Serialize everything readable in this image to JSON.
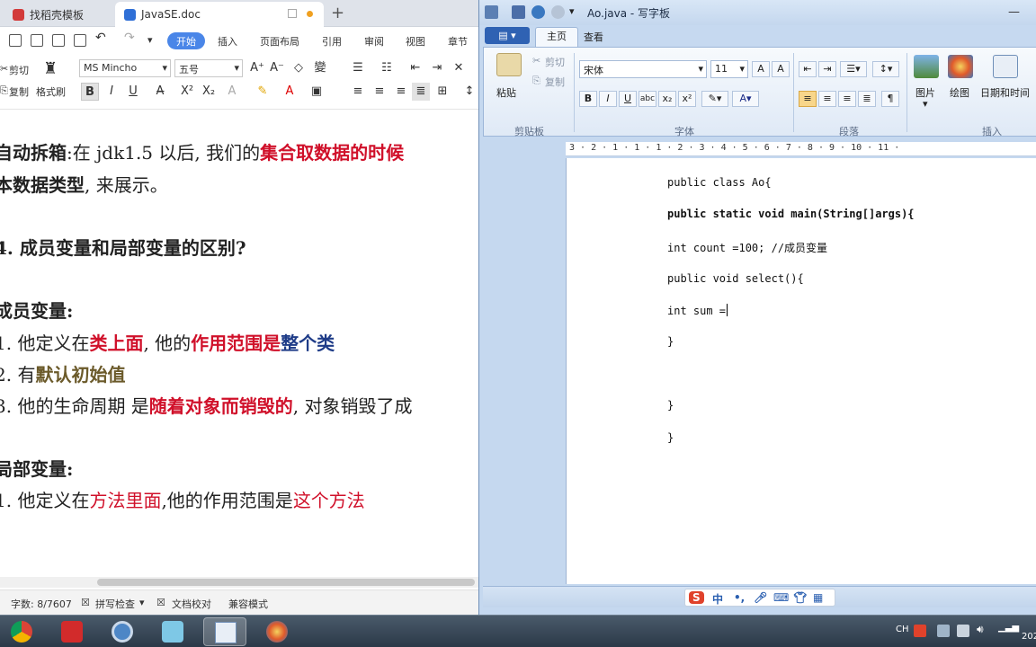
{
  "wps": {
    "tabs": [
      {
        "label": "找稻壳模板",
        "color": "#d23a3a"
      },
      {
        "label": "JavaSE.doc",
        "color": "#2f6fd6"
      }
    ],
    "new_tab": "+",
    "menu": [
      "开始",
      "插入",
      "页面布局",
      "引用",
      "审阅",
      "视图",
      "章节"
    ],
    "clipboard": {
      "cut": "剪切",
      "copy": "复制",
      "format_painter": "格式刷"
    },
    "font_name": "MS Mincho",
    "font_size": "五号",
    "doc_lines": [
      [
        {
          "t": "自动拆箱",
          "c": ""
        },
        {
          "t": ":在 jdk1.5 以后, 我们的",
          "c": ""
        },
        {
          "t": "集合取数据的时候",
          "c": "red b"
        }
      ],
      [
        {
          "t": "本数据类型",
          "c": "b"
        },
        {
          "t": ", 来展示。",
          "c": ""
        }
      ],
      [
        {
          "t": "4.  成员变量和局部变量的区别?",
          "c": "b"
        }
      ],
      [
        {
          "t": "成员变量:",
          "c": "b"
        }
      ],
      [
        {
          "t": "1. 他定义在",
          "c": ""
        },
        {
          "t": "类上面",
          "c": "red b"
        },
        {
          "t": ", 他的",
          "c": ""
        },
        {
          "t": "作用范围是",
          "c": "red b"
        },
        {
          "t": "整个类",
          "c": "blue b"
        }
      ],
      [
        {
          "t": "2. 有",
          "c": ""
        },
        {
          "t": "默认初始值",
          "c": "olive b"
        }
      ],
      [
        {
          "t": "3. 他的生命周期  是",
          "c": ""
        },
        {
          "t": "随着对象而销毁的",
          "c": "red b"
        },
        {
          "t": ", 对象销毁了成",
          "c": ""
        }
      ],
      [
        {
          "t": "局部变量:",
          "c": "b"
        }
      ],
      [
        {
          "t": "1. 他定义在",
          "c": ""
        },
        {
          "t": "方法里面",
          "c": "red"
        },
        {
          "t": ",他的作用范围是",
          "c": ""
        },
        {
          "t": "这个方法",
          "c": "red"
        }
      ]
    ],
    "status": {
      "word_count": "字数: 8/7607",
      "spell": "拼写检查",
      "proof": "文档校对",
      "compat": "兼容模式"
    }
  },
  "wordpad": {
    "title": "Ao.java - 写字板",
    "tabs": {
      "home": "主页",
      "view": "查看"
    },
    "clipboard": {
      "paste": "粘贴",
      "cut": "剪切",
      "copy": "复制",
      "group": "剪贴板"
    },
    "font": {
      "name": "宋体",
      "size": "11",
      "group": "字体"
    },
    "paragraph_group": "段落",
    "insert": {
      "picture": "图片",
      "paint": "绘图",
      "datetime": "日期和时间",
      "group": "插入"
    },
    "ruler": "3 · 2 · 1 · 1 · 1 · 2 · 3 · 4 · 5 · 6 · 7 · 8 · 9 · 10 · 11 ·",
    "code_lines": [
      {
        "text": "public class Ao{",
        "bold": false
      },
      {
        "text": "public static void main(String[]args){",
        "bold": true
      },
      {
        "text": "int count =100; //成员变量",
        "bold": false
      },
      {
        "text": "public void select(){",
        "bold": false
      },
      {
        "text": "int sum =",
        "bold": false
      },
      {
        "text": "}",
        "bold": false
      },
      {
        "text": "}",
        "bold": false
      },
      {
        "text": "}",
        "bold": false
      }
    ],
    "ime": {
      "brand": "S",
      "lang": "中"
    }
  },
  "taskbar": {
    "apps": [
      "chrome",
      "wps",
      "settings",
      "live",
      "wordpad",
      "paint"
    ],
    "tray": {
      "lang": "CH",
      "clock": "202"
    }
  }
}
